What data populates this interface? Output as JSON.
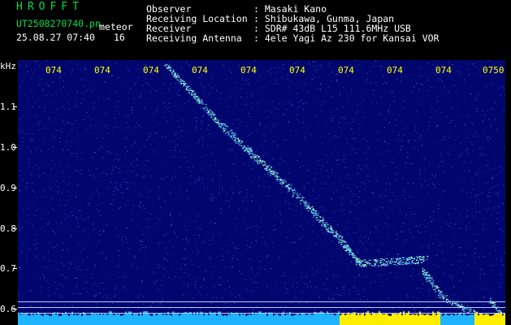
{
  "header": {
    "app_name": "HROFFT",
    "file_name": "UT2508270740.pn",
    "mode": "meteor",
    "datetime": "25.08.27 07:40",
    "count": "16",
    "info": [
      {
        "label": "Observer",
        "value": ": Masaki Kano"
      },
      {
        "label": "Receiving Location",
        "value": ": Shibukawa, Gunma, Japan"
      },
      {
        "label": "Receiver",
        "value": ": SDR# 43dB L15 111.6MHz USB"
      },
      {
        "label": "Receiving Antenna",
        "value": ": 4ele Yagi Az 230 for Kansai VOR"
      }
    ]
  },
  "y_axis": {
    "unit": "kHz",
    "ticks": [
      "1.1",
      "1.0",
      "0.9",
      "0.8",
      "0.7",
      "0.6"
    ]
  },
  "x_axis": {
    "ticks": [
      "074",
      "074",
      "074",
      "074",
      "074",
      "074",
      "074",
      "074",
      "074",
      "0750"
    ]
  },
  "colors": {
    "background": "#000000",
    "spectrogram": "#01066e",
    "title": "#00e04a",
    "text": "#ffffff",
    "time_labels": "#ffff00",
    "trace": "#7fe6c8",
    "band": "#00c8ff",
    "yellow_band": "#ffee00"
  }
}
